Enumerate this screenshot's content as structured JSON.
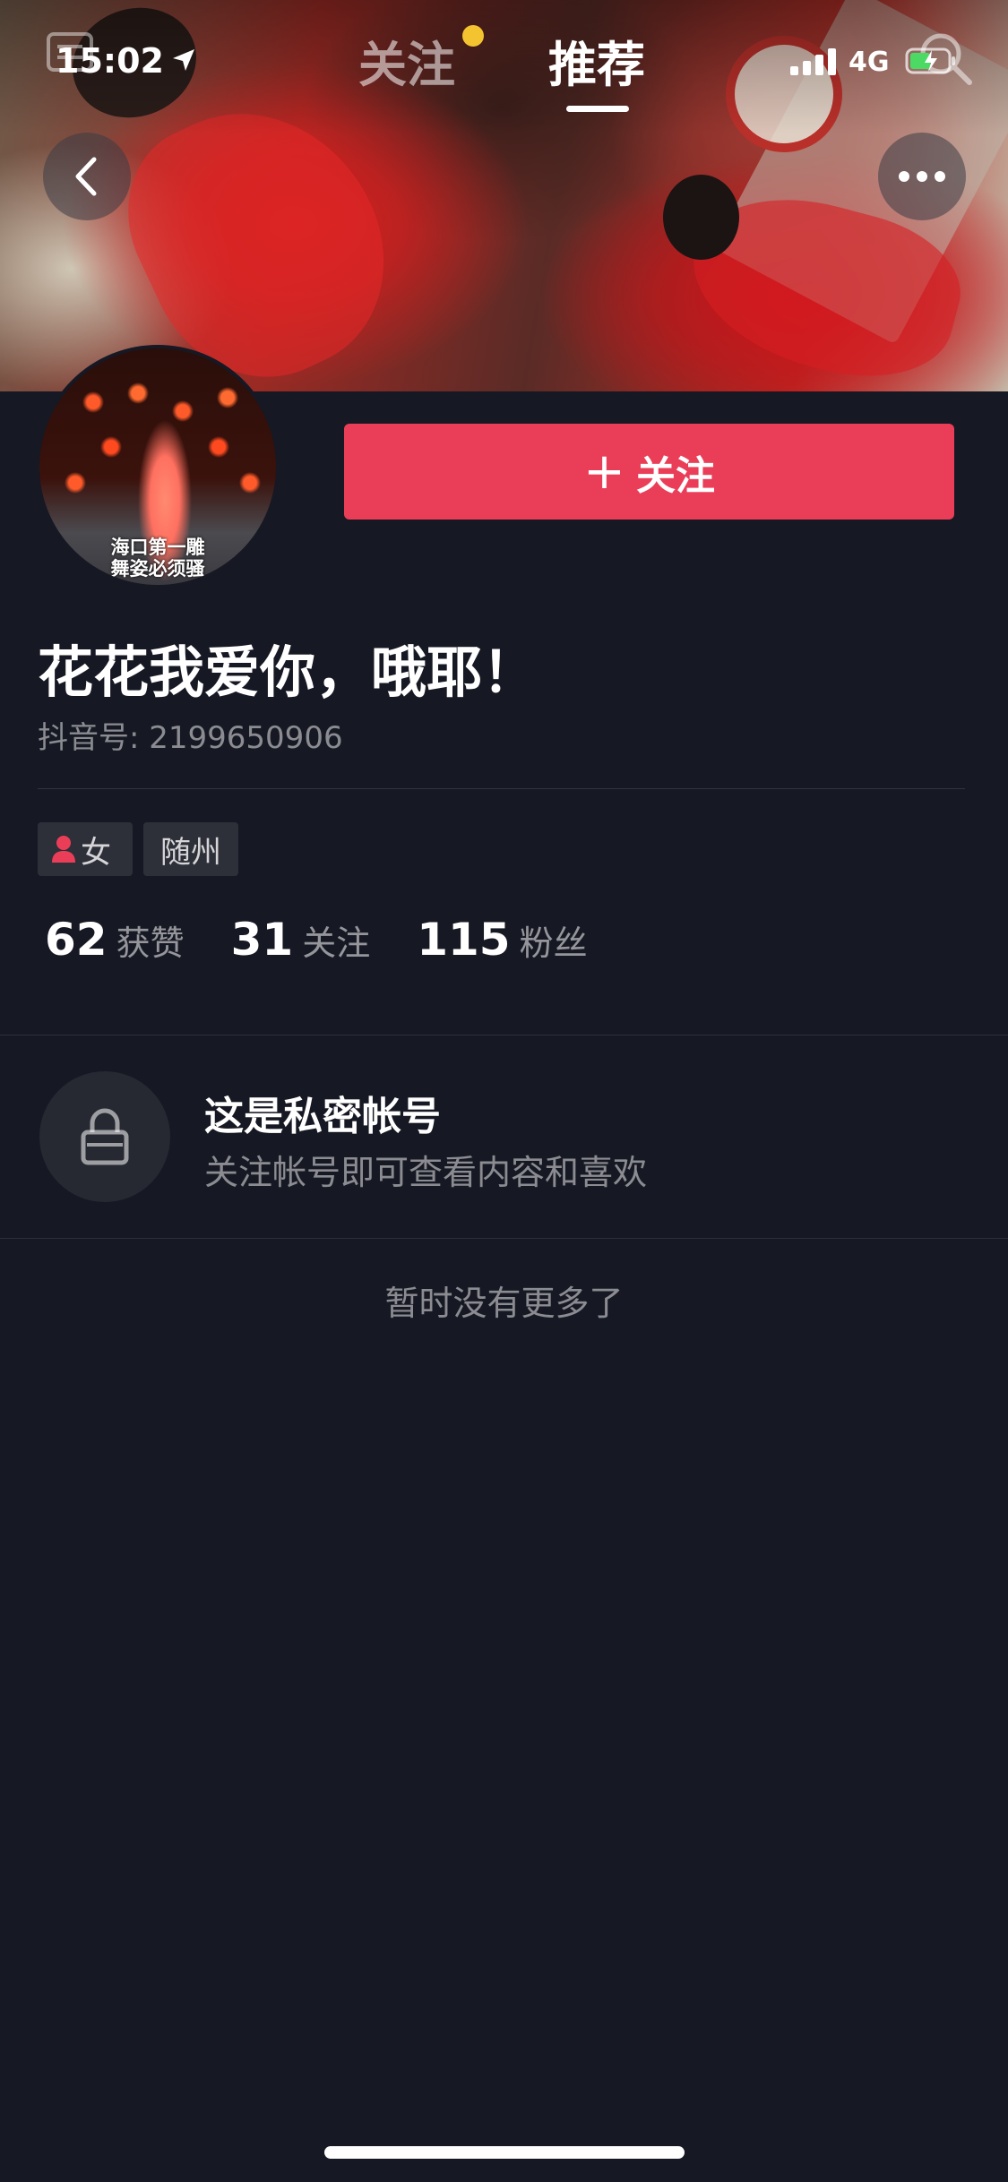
{
  "status_bar": {
    "time": "15:02",
    "network": "4G"
  },
  "top_tabs": {
    "following": "关注",
    "recommend": "推荐"
  },
  "avatar": {
    "caption_line1": "海口第一雕",
    "caption_line2": "舞姿必须骚"
  },
  "follow_button": {
    "plus": "+",
    "label": "关注"
  },
  "profile": {
    "nickname": "花花我爱你，哦耶！",
    "douyin_id": "抖音号: 2199650906",
    "tags": {
      "gender": "女",
      "city": "随州"
    }
  },
  "stats": {
    "likes": {
      "value": "62",
      "label": "获赞"
    },
    "following": {
      "value": "31",
      "label": "关注"
    },
    "followers": {
      "value": "115",
      "label": "粉丝"
    }
  },
  "private": {
    "title": "这是私密帐号",
    "description": "关注帐号即可查看内容和喜欢"
  },
  "footer": {
    "no_more": "暂时没有更多了"
  },
  "colors": {
    "background": "#161823",
    "accent": "#ea3e58",
    "notification_dot": "#f4c430"
  },
  "icons": [
    "location-icon",
    "signal-icon",
    "battery-icon",
    "back-icon",
    "more-icon",
    "gender-female-icon",
    "lock-icon"
  ]
}
